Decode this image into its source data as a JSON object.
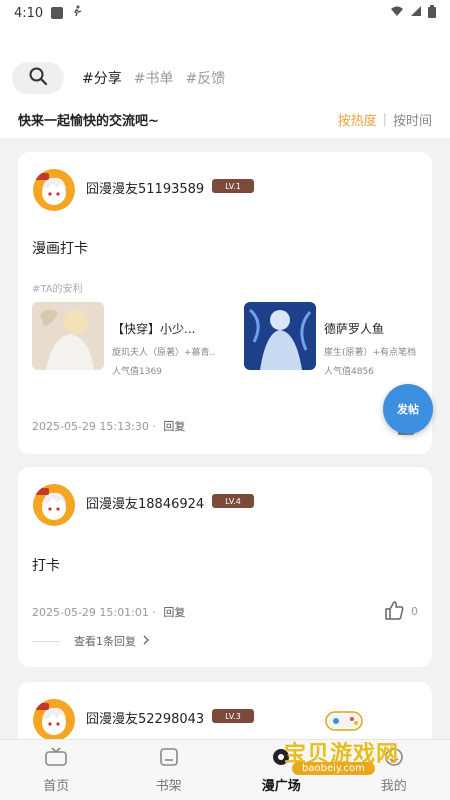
{
  "status_bar": {
    "time": "4:10"
  },
  "header": {
    "tags": [
      "#分享",
      "#书单",
      "#反馈"
    ],
    "subtitle": "快来一起愉快的交流吧~",
    "sort": {
      "hot": "按热度",
      "time": "按时间"
    }
  },
  "posts": [
    {
      "username": "囧漫漫友51193589",
      "level": "LV.1",
      "text": "漫画打卡",
      "ta_label": "#TA的安利",
      "books": [
        {
          "title": "【快穿】小少...",
          "author": "旋玑夫人（原著）+慕青...",
          "popularity": "人气值1369"
        },
        {
          "title": "德萨罗人鱼",
          "author": "崖生(原著）+有点笔档",
          "popularity": "人气值4856"
        }
      ],
      "timestamp": "2025-05-29 15:13:30",
      "reply": "回复"
    },
    {
      "username": "囧漫漫友18846924",
      "level": "LV.4",
      "text": "打卡",
      "timestamp": "2025-05-29 15:01:01",
      "reply": "回复",
      "likes": "0",
      "view_replies": "查看1条回复"
    },
    {
      "username": "囧漫漫友52298043",
      "level": "LV.3"
    }
  ],
  "fab_label": "发帖",
  "bottom_nav": [
    "首页",
    "书架",
    "漫广场",
    "我的"
  ],
  "watermark": {
    "text": "宝贝游戏网",
    "url": "baobeiy.com"
  },
  "colors": {
    "accent": "#f0a040",
    "fab": "#3d8fe0",
    "level_badge": "#7a4a3a",
    "avatar": "#f4a623"
  }
}
